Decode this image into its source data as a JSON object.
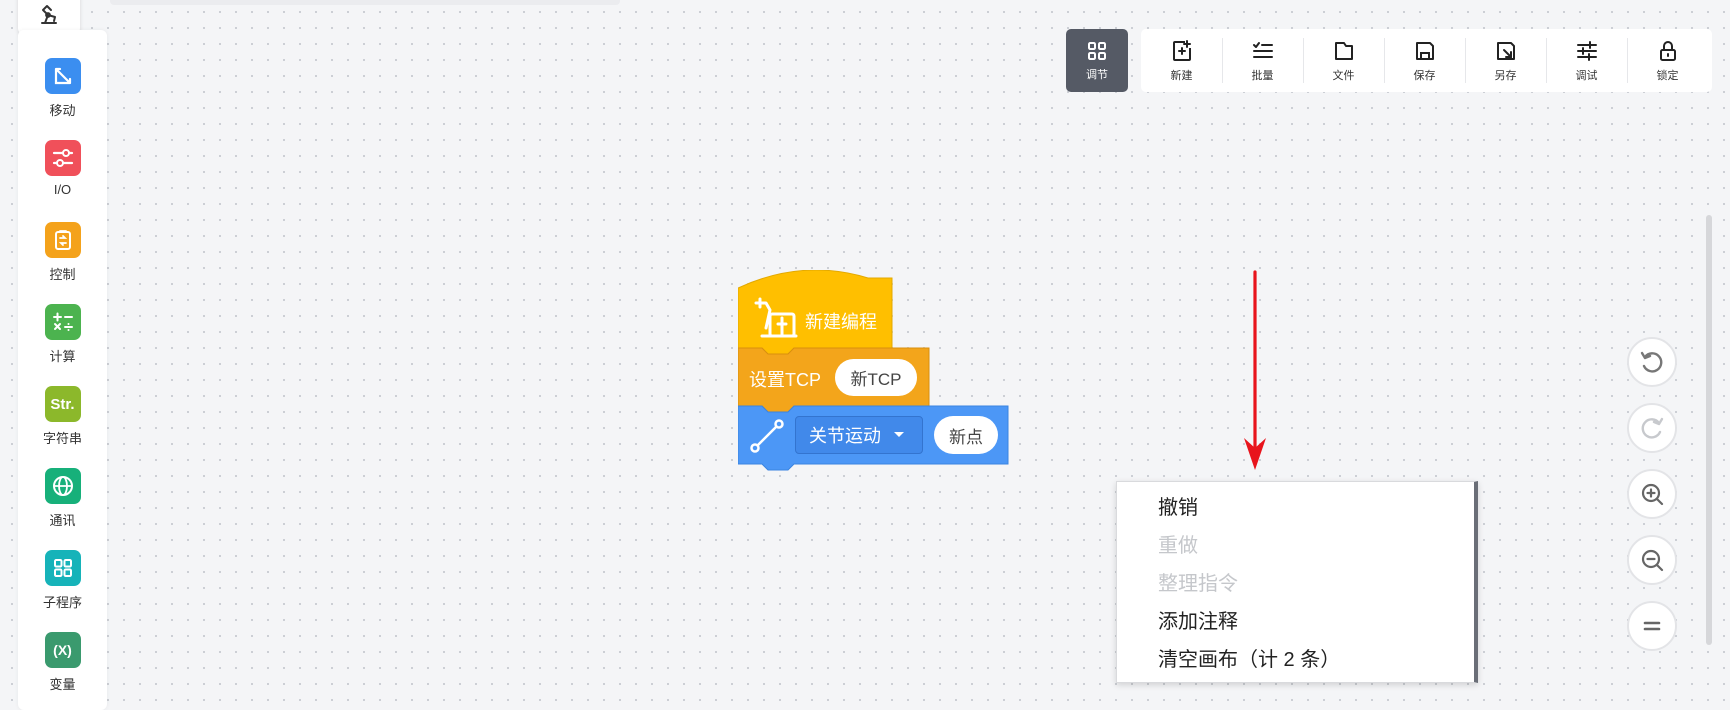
{
  "sidebar": {
    "items": [
      {
        "label": "移动",
        "icon": "move-arrows-icon",
        "color": "#3b8ef0"
      },
      {
        "label": "I/O",
        "icon": "io-sliders-icon",
        "color": "#f0505a"
      },
      {
        "label": "控制",
        "icon": "control-clipboard-icon",
        "color": "#f4a21b"
      },
      {
        "label": "计算",
        "icon": "calculator-icon",
        "color": "#4cb34f"
      },
      {
        "label": "字符串",
        "icon": "string-icon",
        "icon_text": "Str.",
        "color": "#8cb82b"
      },
      {
        "label": "通讯",
        "icon": "globe-icon",
        "color": "#17b07a"
      },
      {
        "label": "子程序",
        "icon": "grid-icon",
        "color": "#16b3b9"
      },
      {
        "label": "变量",
        "icon": "variable-icon",
        "icon_text": "(X)",
        "color": "#3a9a6e"
      }
    ]
  },
  "toolbar": {
    "adjust_label": "调节",
    "buttons": [
      {
        "label": "新建",
        "icon": "new-icon"
      },
      {
        "label": "批量",
        "icon": "batch-list-icon"
      },
      {
        "label": "文件",
        "icon": "file-icon"
      },
      {
        "label": "保存",
        "icon": "save-icon"
      },
      {
        "label": "另存",
        "icon": "save-as-icon"
      },
      {
        "label": "调试",
        "icon": "debug-sliders-icon"
      },
      {
        "label": "锁定",
        "icon": "lock-icon"
      }
    ]
  },
  "blocks": {
    "hat_label": "新建编程",
    "set_tcp_label": "设置TCP",
    "set_tcp_value": "新TCP",
    "joint_move_label": "关节运动",
    "joint_move_point": "新点",
    "colors": {
      "hat": "#ffbf00",
      "tcp": "#f3a51b",
      "move": "#4c97f6"
    }
  },
  "context_menu": {
    "items": [
      {
        "label": "撤销",
        "enabled": true
      },
      {
        "label": "重做",
        "enabled": false
      },
      {
        "label": "整理指令",
        "enabled": false
      },
      {
        "label": "添加注释",
        "enabled": true
      },
      {
        "label": "清空画布（计 2 条）",
        "enabled": true
      }
    ]
  },
  "zoom_controls": [
    "undo-icon",
    "redo-icon",
    "zoom-in-icon",
    "zoom-out-icon",
    "reset-zoom-icon"
  ],
  "annotation": {
    "arrow_color": "#e8141c"
  }
}
